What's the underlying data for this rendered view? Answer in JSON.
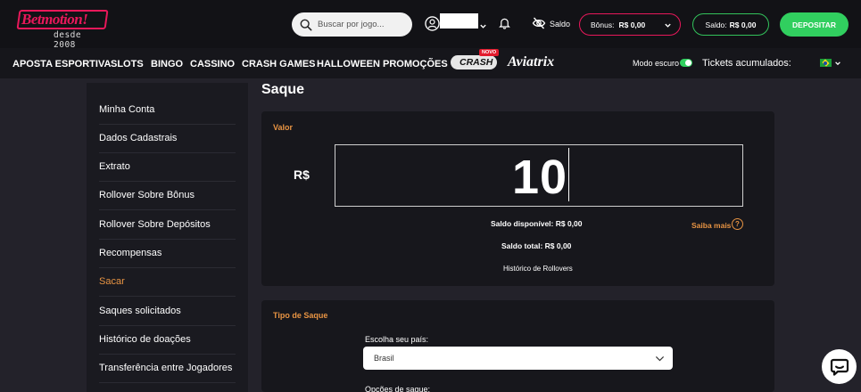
{
  "header": {
    "logo_text": "Betmotion!",
    "logo_sub": "desde 2008",
    "search_placeholder": "Buscar por jogo...",
    "balance_toggle_label": "Saldo",
    "bonus_label": "Bônus:",
    "bonus_value": "R$ 0,00",
    "saldo_label": "Saldo:",
    "saldo_value": "R$ 0,00",
    "deposit_label": "DEPOSITAR"
  },
  "nav": {
    "items": [
      "APOSTA ESPORTIVA",
      "SLOTS",
      "BINGO",
      "CASSINO",
      "CRASH GAMES",
      "HALLOWEEN",
      "PROMOÇÕES"
    ],
    "ninja_crash": "CRASH",
    "ninja_badge": "NOVO",
    "aviatrix": "Aviatrix",
    "dark_mode_label": "Modo escuro",
    "tickets_label": "Tickets acumulados:"
  },
  "sidebar": {
    "items": [
      "Minha Conta",
      "Dados Cadastrais",
      "Extrato",
      "Rollover Sobre Bônus",
      "Rollover Sobre Depósitos",
      "Recompensas",
      "Sacar",
      "Saques solicitados",
      "Histórico de doações",
      "Transferência entre Jogadores"
    ],
    "active_index": 6
  },
  "main": {
    "title": "Saque",
    "valor": {
      "label": "Valor",
      "currency": "R$",
      "amount": "10",
      "saldo_disponivel": "Saldo disponível: R$ 0,00",
      "saldo_total": "Saldo total: R$ 0,00",
      "historico": "Histórico de Rollovers",
      "saiba_mais": "Saiba mais"
    },
    "tipo": {
      "label": "Tipo de Saque",
      "country_label": "Escolha seu país:",
      "country_value": "Brasil",
      "options_label": "Opções de saque:"
    }
  },
  "colors": {
    "accent_orange": "#e89443",
    "brand_pink": "#e8185a",
    "green": "#31cf5f"
  }
}
